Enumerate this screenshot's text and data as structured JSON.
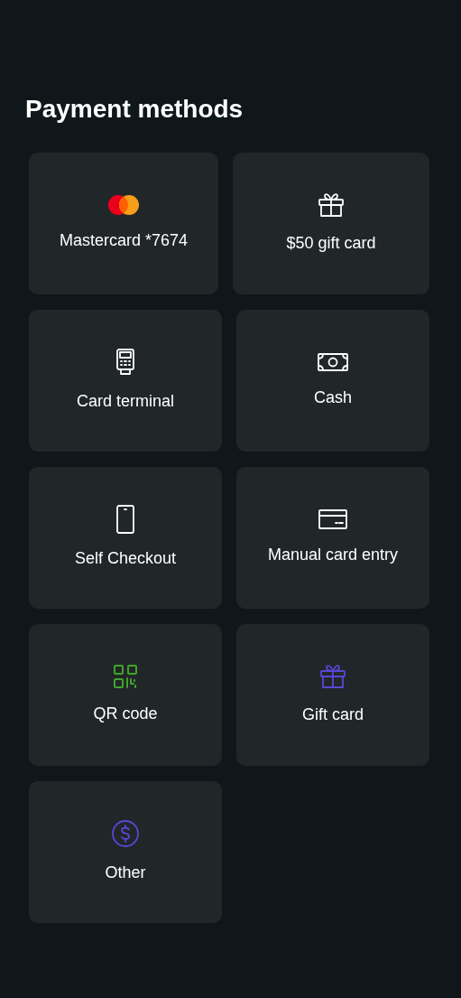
{
  "title": "Payment methods",
  "rows": [
    {
      "items": [
        {
          "kind": "mastercard",
          "label": "Mastercard *7674"
        },
        {
          "kind": "gift",
          "label": "$50 gift card",
          "color": "#ffffff"
        }
      ]
    },
    {
      "items": [
        {
          "kind": "terminal",
          "label": "Card terminal",
          "color": "#ffffff"
        },
        {
          "kind": "cash",
          "label": "Cash",
          "color": "#ffffff"
        }
      ]
    },
    {
      "items": [
        {
          "kind": "phone",
          "label": "Self Checkout",
          "color": "#ffffff"
        },
        {
          "kind": "card",
          "label": "Manual card entry",
          "color": "#ffffff"
        }
      ]
    },
    {
      "items": [
        {
          "kind": "qr",
          "label": "QR code",
          "color": "#3fa52a"
        },
        {
          "kind": "gift",
          "label": "Gift card",
          "color": "#5b46d6"
        }
      ]
    },
    {
      "items": [
        {
          "kind": "dollar",
          "label": "Other",
          "color": "#5b46d6"
        }
      ]
    }
  ]
}
